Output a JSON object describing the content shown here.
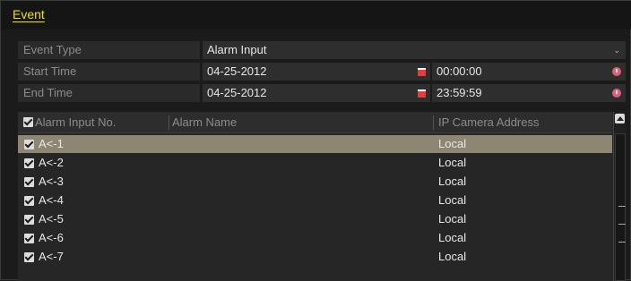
{
  "header": {
    "title": "Event"
  },
  "form": {
    "event_type": {
      "label": "Event Type",
      "value": "Alarm Input"
    },
    "start_time": {
      "label": "Start Time",
      "date": "04-25-2012",
      "time": "00:00:00"
    },
    "end_time": {
      "label": "End Time",
      "date": "04-25-2012",
      "time": "23:59:59"
    }
  },
  "table": {
    "columns": [
      "Alarm Input No.",
      "Alarm Name",
      "IP Camera Address"
    ],
    "rows": [
      {
        "no": "A<-1",
        "name": "",
        "camera": "Local",
        "checked": true,
        "selected": true
      },
      {
        "no": "A<-2",
        "name": "",
        "camera": "Local",
        "checked": true,
        "selected": false
      },
      {
        "no": "A<-3",
        "name": "",
        "camera": "Local",
        "checked": true,
        "selected": false
      },
      {
        "no": "A<-4",
        "name": "",
        "camera": "Local",
        "checked": true,
        "selected": false
      },
      {
        "no": "A<-5",
        "name": "",
        "camera": "Local",
        "checked": true,
        "selected": false
      },
      {
        "no": "A<-6",
        "name": "",
        "camera": "Local",
        "checked": true,
        "selected": false
      },
      {
        "no": "A<-7",
        "name": "",
        "camera": "Local",
        "checked": true,
        "selected": false
      }
    ]
  },
  "colors": {
    "accent": "#f2e200",
    "selected_row": "#8d8672",
    "calendar_icon": "#e63c3c",
    "clock_icon": "#e85a78"
  }
}
